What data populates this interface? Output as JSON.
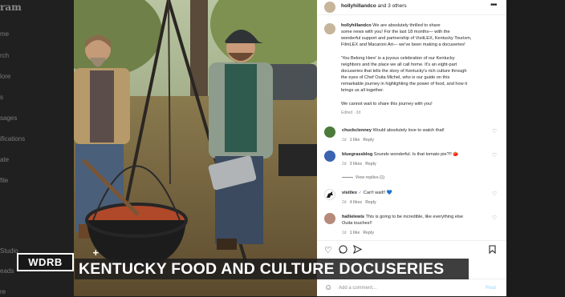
{
  "left_nav": {
    "brand": "ram",
    "items": [
      "me",
      "rch",
      "lore",
      "s",
      "sages",
      "ifications",
      "ate",
      "file",
      "Studio",
      "eads",
      "re"
    ]
  },
  "post": {
    "header_author": "hollyhillandco",
    "header_suffix": "and 3 others",
    "caption": {
      "user": "hollyhillandco",
      "paragraphs": [
        [
          "We are absolutely thrilled to share",
          "some news with you! For the last 18 months— with the",
          "wonderful support and partnership of VisitLEX, Kentucky Tourism,",
          "FilmLEX and Macaroni Art— we've been making a docuseries!"
        ],
        [
          "'You Belong Here' is a joyous celebration of our Kentucky",
          "neighbors and the place we all call home. It's an eight-part",
          "docuseries that tells the story of Kentucky's rich culture through",
          "the eyes of Chef Ouita Michel, who is our guide on this",
          "remarkable journey in highlighting the power of food, and how it",
          "brings us all together."
        ],
        [
          "We cannot wait to share this journey with you!"
        ]
      ],
      "meta": "Edited · 2d"
    },
    "comments": [
      {
        "user": "chuckclenney",
        "text": "Would absolutely love to watch that!",
        "age": "1d",
        "likes": "1 like",
        "reply": "Reply"
      },
      {
        "user": "bluegrassblog",
        "text": "Sounds wonderful. Is that tomato pie?!! 🍅",
        "age": "2d",
        "likes": "3 likes",
        "reply": "Reply",
        "view_replies": "View replies (1)"
      },
      {
        "user": "visitlex",
        "text": "Can't wait!! 💙",
        "age": "2d",
        "likes": "4 likes",
        "reply": "Reply",
        "verified": "✓"
      },
      {
        "user": "hallielewis",
        "text": "This is going to be incredible, like everything else",
        "text2": "Ouita touches!!",
        "age": "1d",
        "likes": "1 like",
        "reply": "Reply"
      }
    ],
    "comment_placeholder": "Add a comment...",
    "post_button": "Post"
  },
  "broadcast": {
    "station_logo": "WDRB",
    "logo_plus": "+",
    "headline": "KENTUCKY FOOD AND CULTURE DOCUSERIES"
  },
  "colors": {
    "panel_bg": "#ffffff",
    "verified": "#3897f0",
    "post_button": "#b2dffc",
    "lower_third": "#1e1e1e"
  }
}
